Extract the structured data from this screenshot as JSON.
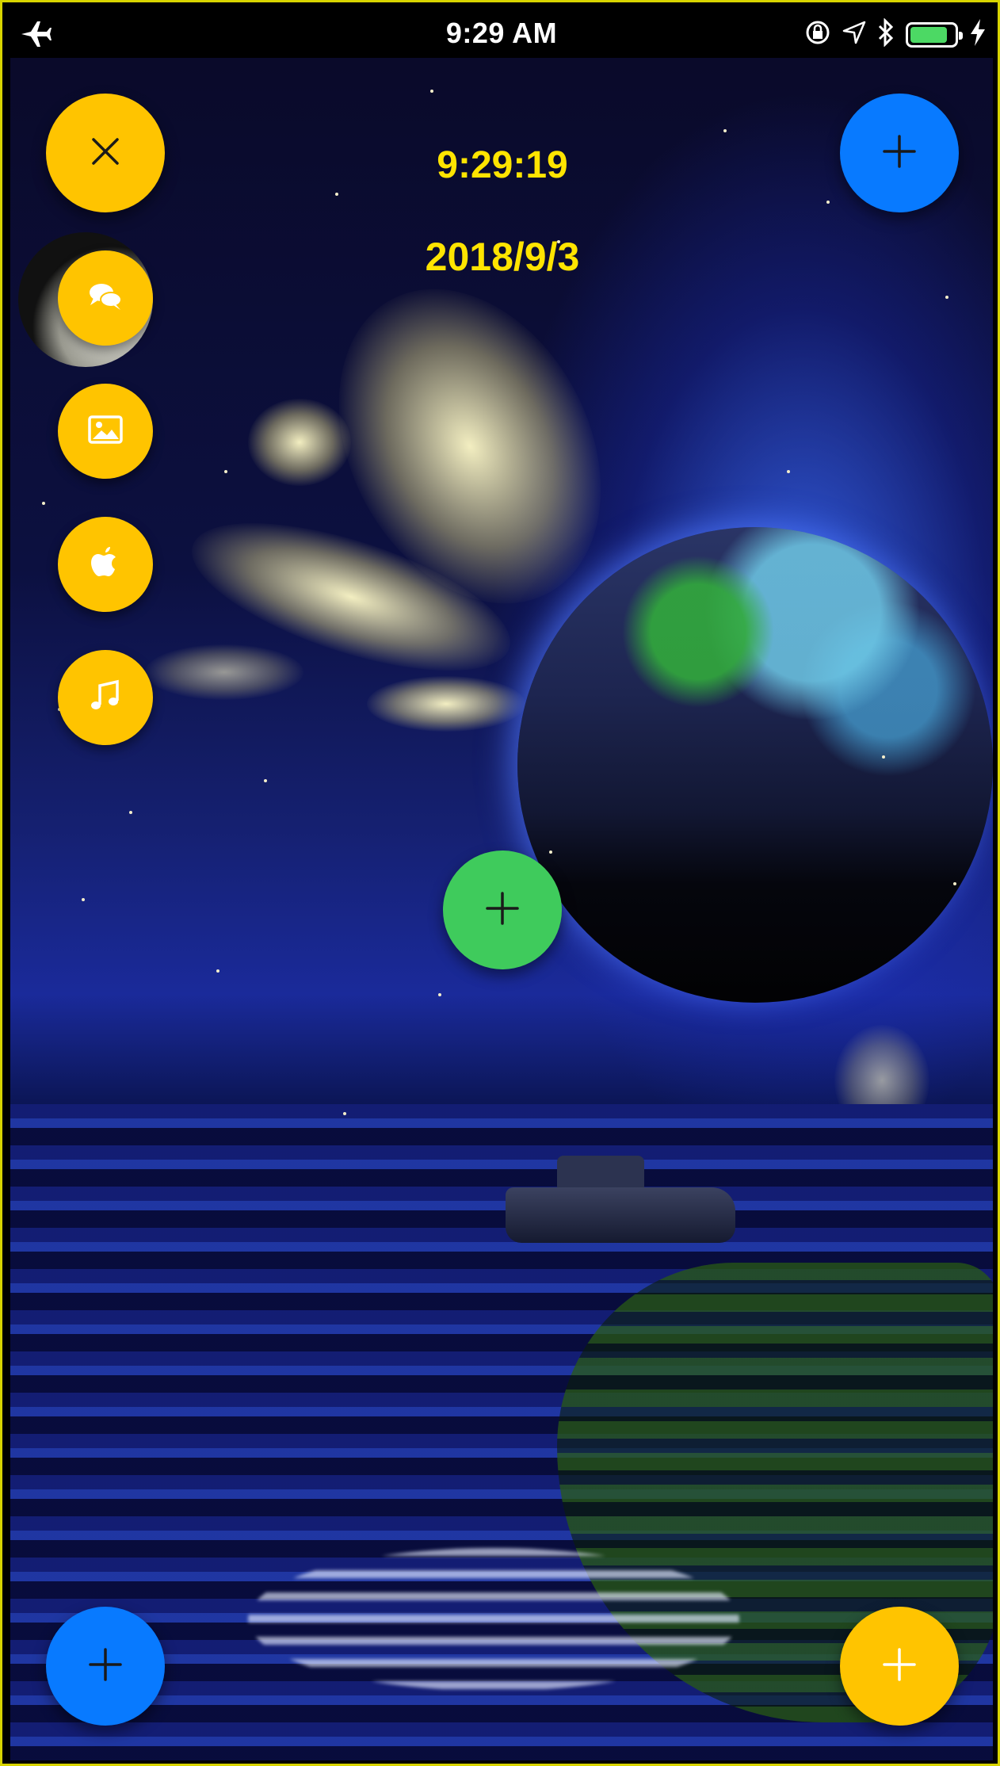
{
  "status_bar": {
    "time": "9:29 AM",
    "left_icon": "airplane-icon",
    "right_icons": [
      "rotation-lock-icon",
      "location-arrow-icon",
      "bluetooth-icon",
      "battery-icon",
      "charging-bolt-icon"
    ],
    "battery_level": 0.85,
    "battery_color": "#4cd964"
  },
  "overlay": {
    "time": "9:29:19",
    "date": "2018/9/3",
    "text_color": "#ffe400"
  },
  "buttons": {
    "close": {
      "icon": "close-icon",
      "color": "#ffc400"
    },
    "top_right_add": {
      "icon": "plus-icon",
      "color": "#087aff"
    },
    "center_add": {
      "icon": "plus-icon",
      "color": "#3fcb5c"
    },
    "bottom_left_add": {
      "icon": "plus-icon",
      "color": "#087aff"
    },
    "bottom_right_add": {
      "icon": "plus-icon",
      "color": "#ffc400"
    }
  },
  "menu_items": [
    {
      "icon": "chat-bubbles-icon"
    },
    {
      "icon": "image-icon"
    },
    {
      "icon": "apple-icon"
    },
    {
      "icon": "music-note-icon"
    }
  ]
}
